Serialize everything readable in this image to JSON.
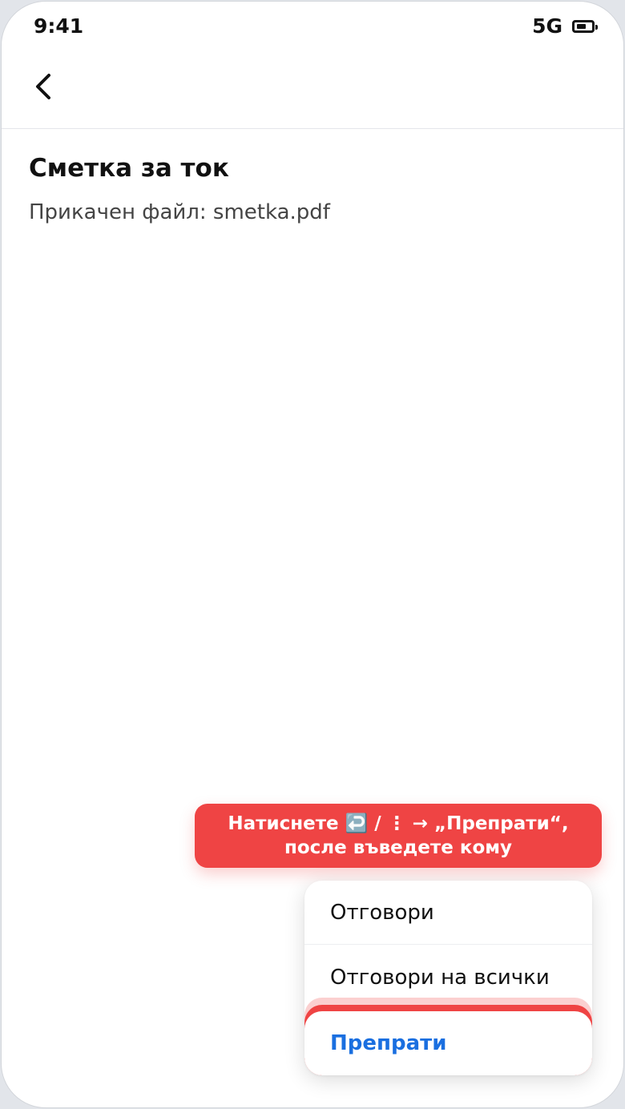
{
  "status_bar": {
    "time": "9:41",
    "network": "5G"
  },
  "app_bar": {
    "back_icon": "chevron-left-icon"
  },
  "mail": {
    "subject": "Сметка за ток",
    "attachment": "Прикачен файл: smetka.pdf"
  },
  "hint": {
    "line1": "Натиснете ↩️ / ⋮ → „Препрати“,",
    "line2": "после въведете кому"
  },
  "menu": {
    "reply": "Отговори",
    "reply_all": "Отговори на всички",
    "forward": "Препрати"
  },
  "colors": {
    "hint_bg": "#ef4444",
    "forward_text": "#1a6fe0",
    "highlight_soft": "#fbd0d0"
  }
}
